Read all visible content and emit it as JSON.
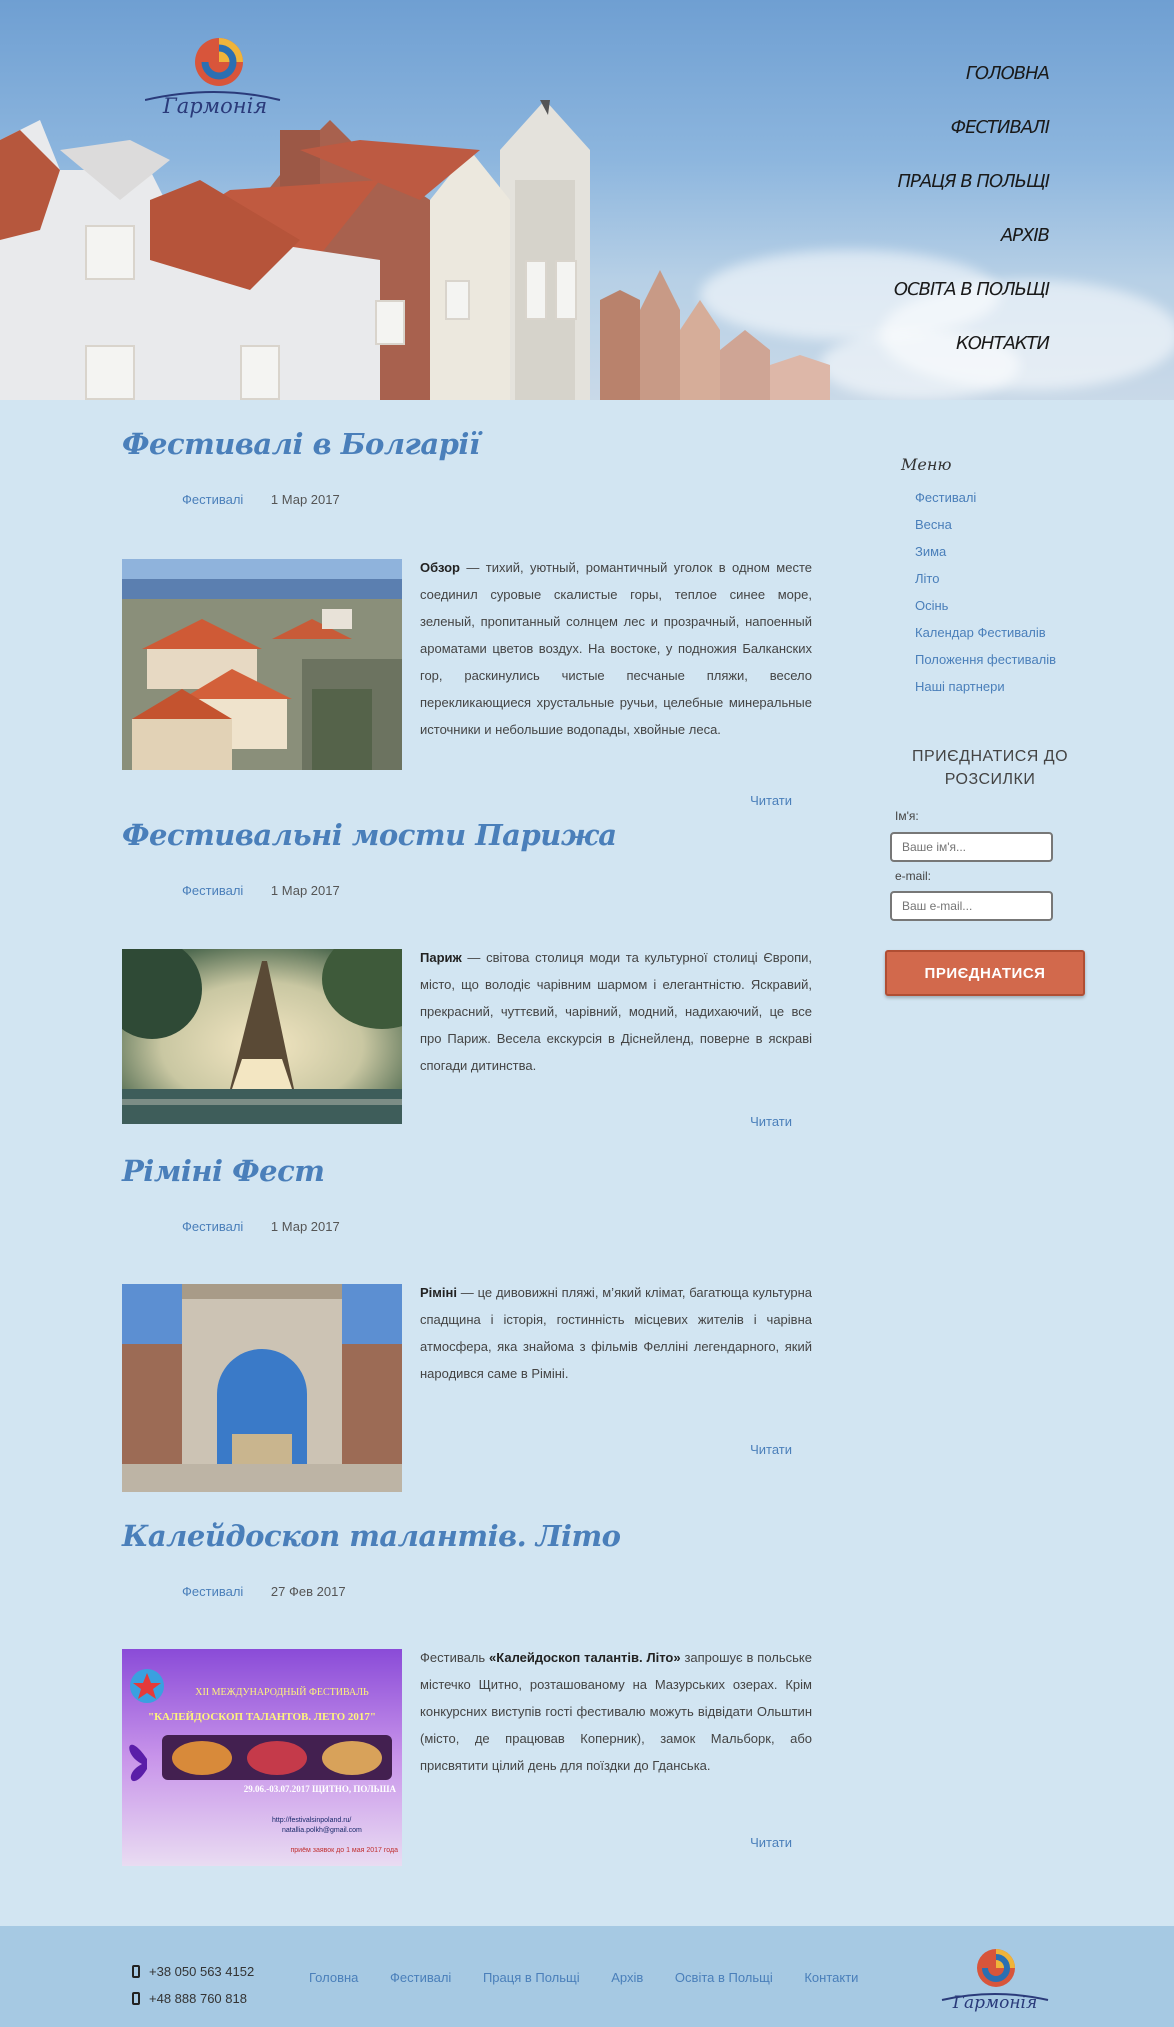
{
  "brand": {
    "logo_text": "Гармонія"
  },
  "nav": [
    "ГОЛОВНА",
    "ФЕСТИВАЛІ",
    "ПРАЦЯ В ПОЛЬЩІ",
    "АРХІВ",
    "ОСВІТА В ПОЛЬЩІ",
    "КОНТАКТИ"
  ],
  "posts": [
    {
      "title": "Фестивалі в Болгарії",
      "category": "Фестивалі",
      "date": "1 Мар 2017",
      "lead": "Обзор",
      "text": " — тихий, уютный, романтичный уголок в одном месте соединил суровые скалистые горы, теплое синее море, зеленый, пропитанный солнцем лес и прозрачный, напоенный ароматами цветов воздух. На востоке, у подножия Балканских гор, раскинулись чистые песчаные пляжи, весело перекликающиеся хрустальные ручьи, целебные минеральные источники и небольшие водопады, хвойные леса.",
      "read_more": "Читати"
    },
    {
      "title": "Фестивальні мости Парижа",
      "category": "Фестивалі",
      "date": "1 Мар 2017",
      "lead": "Париж",
      "text": " — світова столиця моди та культурної столиці Європи,  місто, що володіє чарівним шармом і елегантністю. Яскравий, прекрасний, чуттєвий, чарівний, модний, надихаючий, це все про Париж. Весела екскурсія в Діснейленд, поверне в яскраві спогади дитинства.",
      "read_more": "Читати"
    },
    {
      "title": "Ріміні Фест",
      "category": "Фестивалі",
      "date": "1 Мар 2017",
      "lead": "Ріміні",
      "text": " — це дивовижні пляжі, м’який клімат, багатюща культурна спадщина і історія, гостинність місцевих жителів і чарівна атмосфера, яка знайома з фільмів Фелліні легендарного, який народився саме в Ріміні.",
      "read_more": "Читати"
    },
    {
      "title": "Калейдоскоп талантів. Літо",
      "category": "Фестивалі",
      "date": "27 Фев 2017",
      "lead_prefix": "Фестиваль ",
      "lead": "«Калейдоскоп талантів. Літо»",
      "text": " запрошує в польське містечко Щитно, розташованому на Мазурських озерах. Крім конкурсних виступів гості фестивалю можуть відвідати Ольштин (місто, де працював Коперник), замок Мальборк, або присвятити цілий день для поїздки до Гданська.",
      "read_more": "Читати",
      "poster": {
        "line1": "XII МЕЖДУНАРОДНЫЙ ФЕСТИВАЛЬ",
        "line2": "\"КАЛЕЙДОСКОП ТАЛАНТОВ. ЛЕТО 2017\"",
        "dates": "29.06.-03.07.2017 ЩИТНО, ПОЛЬША",
        "site": "http://festivalsinpoland.ru/",
        "email": "natallia.polkh@gmail.com",
        "deadline": "приём заявок до 1 мая 2017 года"
      }
    }
  ],
  "sidebar": {
    "title": "Меню",
    "items": [
      "Фестивалі",
      "Весна",
      "Зима",
      "Літо",
      "Осінь",
      "Календар Фестивалів",
      "Положення фестивалів",
      "Наші партнери"
    ],
    "subscribe_title": "ПРИЄДНАТИСЯ ДО РОЗСИЛКИ",
    "name_label": "Ім'я:",
    "name_placeholder": "Ваше ім'я...",
    "email_label": "e-mail:",
    "email_placeholder": "Ваш e-mail...",
    "button": "ПРИЄДНАТИСЯ"
  },
  "footer": {
    "phones": [
      "+38 050 563 4152",
      "+48 888 760 818"
    ],
    "nav": [
      "Головна",
      "Фестивалі",
      "Праця в Польщі",
      "Архів",
      "Освіта в Польщі",
      "Контакти"
    ]
  },
  "colors": {
    "accent": "#4a7fba",
    "button": "#d2694c",
    "page_bg": "#d2e5f2",
    "footer_bg": "#a6c9e3"
  }
}
